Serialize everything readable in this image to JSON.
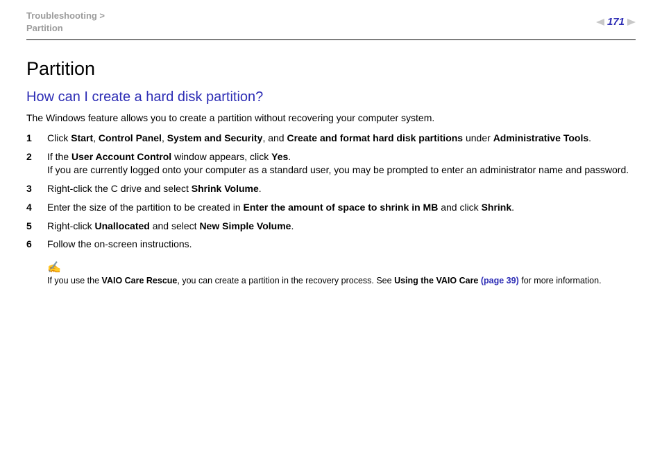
{
  "breadcrumb": {
    "line1": "Troubleshooting >",
    "line2": "Partition"
  },
  "page_number": "171",
  "title": "Partition",
  "question": "How can I create a hard disk partition?",
  "intro": "The Windows feature allows you to create a partition without recovering your computer system.",
  "steps": {
    "s1": {
      "pre": "Click ",
      "b1": "Start",
      "t1": ", ",
      "b2": "Control Panel",
      "t2": ", ",
      "b3": "System and Security",
      "t3": ", and ",
      "b4": "Create and format hard disk partitions",
      "t4": " under ",
      "b5": "Administrative Tools",
      "t5": "."
    },
    "s2": {
      "pre": "If the ",
      "b1": "User Account Control",
      "t1": " window appears, click ",
      "b2": "Yes",
      "t2": ".",
      "br": "If you are currently logged onto your computer as a standard user, you may be prompted to enter an administrator name and password."
    },
    "s3": {
      "pre": "Right-click the C drive and select ",
      "b1": "Shrink Volume",
      "t1": "."
    },
    "s4": {
      "pre": "Enter the size of the partition to be created in ",
      "b1": "Enter the amount of space to shrink in MB",
      "t1": " and click ",
      "b2": "Shrink",
      "t2": "."
    },
    "s5": {
      "pre": "Right-click ",
      "b1": "Unallocated",
      "t1": " and select ",
      "b2": "New Simple Volume",
      "t2": "."
    },
    "s6": {
      "pre": "Follow the on-screen instructions."
    }
  },
  "note": {
    "icon": "✍",
    "t1": "If you use the ",
    "b1": "VAIO Care Rescue",
    "t2": ", you can create a partition in the recovery process. See ",
    "b2": "Using the VAIO Care ",
    "link": "(page 39)",
    "t3": " for more information."
  }
}
